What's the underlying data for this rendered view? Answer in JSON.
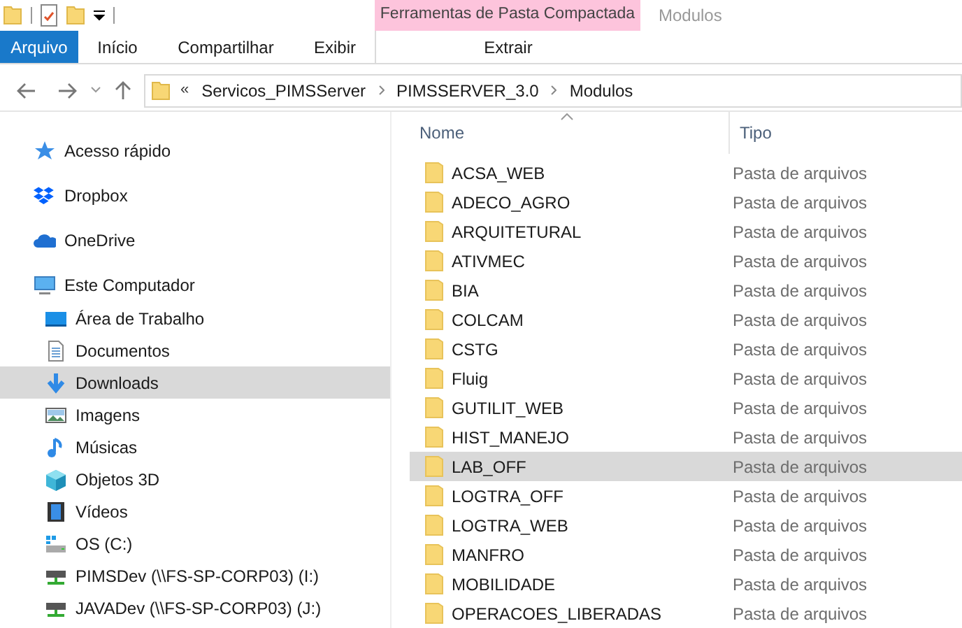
{
  "window": {
    "title": "Modulos"
  },
  "ribbon": {
    "context_group": "Ferramentas de Pasta Compactada",
    "tabs": [
      {
        "label": "Arquivo",
        "kind": "file"
      },
      {
        "label": "Início",
        "kind": "tab"
      },
      {
        "label": "Compartilhar",
        "kind": "tab"
      },
      {
        "label": "Exibir",
        "kind": "tab"
      },
      {
        "label": "Extrair",
        "kind": "context"
      }
    ]
  },
  "address_bar": {
    "overflow": "«",
    "path": [
      "Servicos_PIMSServer",
      "PIMSSERVER_3.0",
      "Modulos"
    ]
  },
  "sidebar": {
    "items": [
      {
        "label": "Acesso rápido",
        "kind": "star",
        "selected": false
      },
      {
        "label": "Dropbox",
        "kind": "dropbox",
        "selected": false
      },
      {
        "label": "OneDrive",
        "kind": "cloud",
        "selected": false
      },
      {
        "label": "Este Computador",
        "kind": "computer",
        "selected": false,
        "children": [
          {
            "label": "Área de Trabalho",
            "kind": "desktop",
            "selected": false
          },
          {
            "label": "Documentos",
            "kind": "document",
            "selected": false
          },
          {
            "label": "Downloads",
            "kind": "download",
            "selected": true
          },
          {
            "label": "Imagens",
            "kind": "image",
            "selected": false
          },
          {
            "label": "Músicas",
            "kind": "music",
            "selected": false
          },
          {
            "label": "Objetos 3D",
            "kind": "cube",
            "selected": false
          },
          {
            "label": "Vídeos",
            "kind": "film",
            "selected": false
          },
          {
            "label": "OS (C:)",
            "kind": "drive",
            "selected": false
          },
          {
            "label": "PIMSDev (\\\\FS-SP-CORP03) (I:)",
            "kind": "netdrive",
            "selected": false
          },
          {
            "label": "JAVADev (\\\\FS-SP-CORP03) (J:)",
            "kind": "netdrive",
            "selected": false
          }
        ]
      }
    ]
  },
  "table": {
    "columns": [
      "Nome",
      "Tipo"
    ],
    "rows": [
      {
        "name": "ACSA_WEB",
        "type": "Pasta de arquivos",
        "selected": false
      },
      {
        "name": "ADECO_AGRO",
        "type": "Pasta de arquivos",
        "selected": false
      },
      {
        "name": "ARQUITETURAL",
        "type": "Pasta de arquivos",
        "selected": false
      },
      {
        "name": "ATIVMEC",
        "type": "Pasta de arquivos",
        "selected": false
      },
      {
        "name": "BIA",
        "type": "Pasta de arquivos",
        "selected": false
      },
      {
        "name": "COLCAM",
        "type": "Pasta de arquivos",
        "selected": false
      },
      {
        "name": "CSTG",
        "type": "Pasta de arquivos",
        "selected": false
      },
      {
        "name": "Fluig",
        "type": "Pasta de arquivos",
        "selected": false
      },
      {
        "name": "GUTILIT_WEB",
        "type": "Pasta de arquivos",
        "selected": false
      },
      {
        "name": "HIST_MANEJO",
        "type": "Pasta de arquivos",
        "selected": false
      },
      {
        "name": "LAB_OFF",
        "type": "Pasta de arquivos",
        "selected": true
      },
      {
        "name": "LOGTRA_OFF",
        "type": "Pasta de arquivos",
        "selected": false
      },
      {
        "name": "LOGTRA_WEB",
        "type": "Pasta de arquivos",
        "selected": false
      },
      {
        "name": "MANFRO",
        "type": "Pasta de arquivos",
        "selected": false
      },
      {
        "name": "MOBILIDADE",
        "type": "Pasta de arquivos",
        "selected": false
      },
      {
        "name": "OPERACOES_LIBERADAS",
        "type": "Pasta de arquivos",
        "selected": false
      }
    ]
  }
}
